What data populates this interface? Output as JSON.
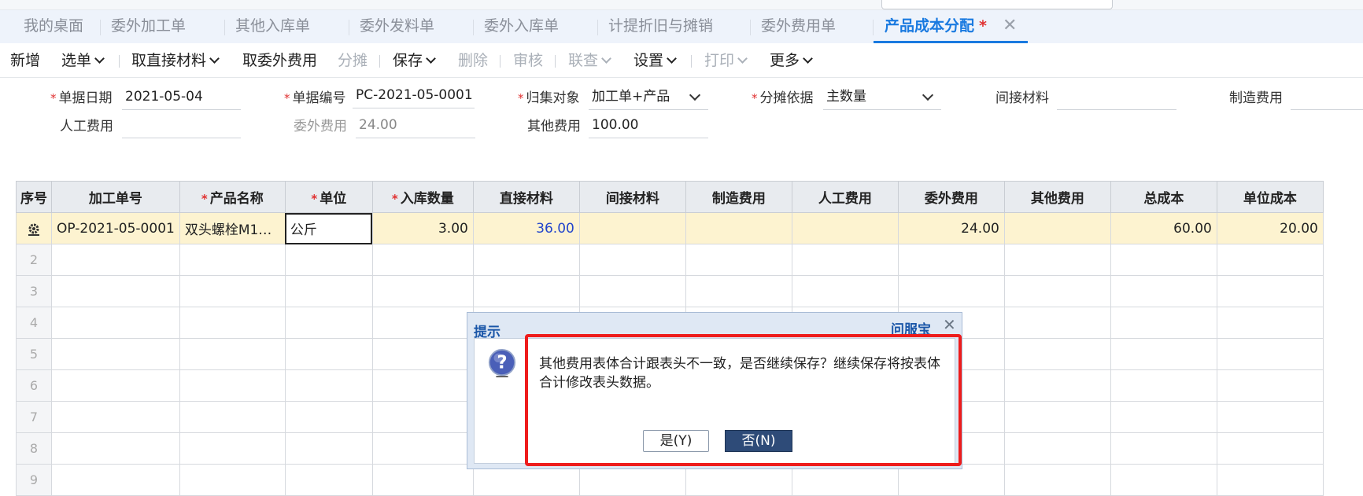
{
  "tabs": [
    {
      "label": "我的桌面"
    },
    {
      "label": "委外加工单"
    },
    {
      "label": "其他入库单"
    },
    {
      "label": "委外发料单"
    },
    {
      "label": "委外入库单"
    },
    {
      "label": "计提折旧与摊销"
    },
    {
      "label": "委外费用单"
    },
    {
      "label": "产品成本分配",
      "dirty_mark": "*",
      "close_glyph": "✕"
    }
  ],
  "toolbar": {
    "new": "新增",
    "select": "选单",
    "take_direct_material": "取直接材料",
    "take_outsourcing_fee": "取委外费用",
    "allocate": "分摊",
    "save": "保存",
    "delete": "删除",
    "audit": "审核",
    "link_query": "联查",
    "settings": "设置",
    "print": "打印",
    "more": "更多"
  },
  "form": {
    "required_mark": "*",
    "doc_date": {
      "label": "单据日期",
      "value": "2021-05-04"
    },
    "doc_no": {
      "label": "单据编号",
      "value": "PC-2021-05-0001"
    },
    "collect_target": {
      "label": "归集对象",
      "value": "加工单+产品"
    },
    "allocation_basis": {
      "label": "分摊依据",
      "value": "主数量"
    },
    "indirect_material": {
      "label": "间接材料",
      "value": ""
    },
    "manufacturing_cost": {
      "label": "制造费用",
      "value": ""
    },
    "labor_cost": {
      "label": "人工费用",
      "value": ""
    },
    "outsourcing_cost": {
      "label": "委外费用",
      "value": "24.00"
    },
    "other_cost": {
      "label": "其他费用",
      "value": "100.00"
    }
  },
  "grid": {
    "headers": {
      "seq": "序号",
      "order_no": "加工单号",
      "product_name": "产品名称",
      "unit": "单位",
      "in_qty": "入库数量",
      "direct_material": "直接材料",
      "indirect_material": "间接材料",
      "manufacturing_cost": "制造费用",
      "labor_cost": "人工费用",
      "outsourcing_cost": "委外费用",
      "other_cost": "其他费用",
      "total_cost": "总成本",
      "unit_cost": "单位成本"
    },
    "row1": {
      "order_no": "OP-2021-05-0001",
      "product_name": "双头螺栓M1…",
      "unit": "公斤",
      "in_qty": "3.00",
      "direct_material": "36.00",
      "indirect_material": "",
      "manufacturing_cost": "",
      "labor_cost": "",
      "outsourcing_cost": "24.00",
      "other_cost": "",
      "total_cost": "60.00",
      "unit_cost": "20.00"
    },
    "row_numbers": [
      "2",
      "3",
      "4",
      "5",
      "6",
      "7",
      "8",
      "9"
    ]
  },
  "dialog": {
    "title": "提示",
    "link": "问服宝",
    "close_glyph": "✕",
    "message": "其他费用表体合计跟表头不一致，是否继续保存？继续保存将按表体合计修改表头数据。",
    "yes_label": "是(Y)",
    "no_label": "否(N)"
  },
  "colors": {
    "accent": "#1a7ae0",
    "highlight_row": "#fdf3d0",
    "annotation_box": "#ee1c1c",
    "primary_button": "#2e4b78"
  }
}
